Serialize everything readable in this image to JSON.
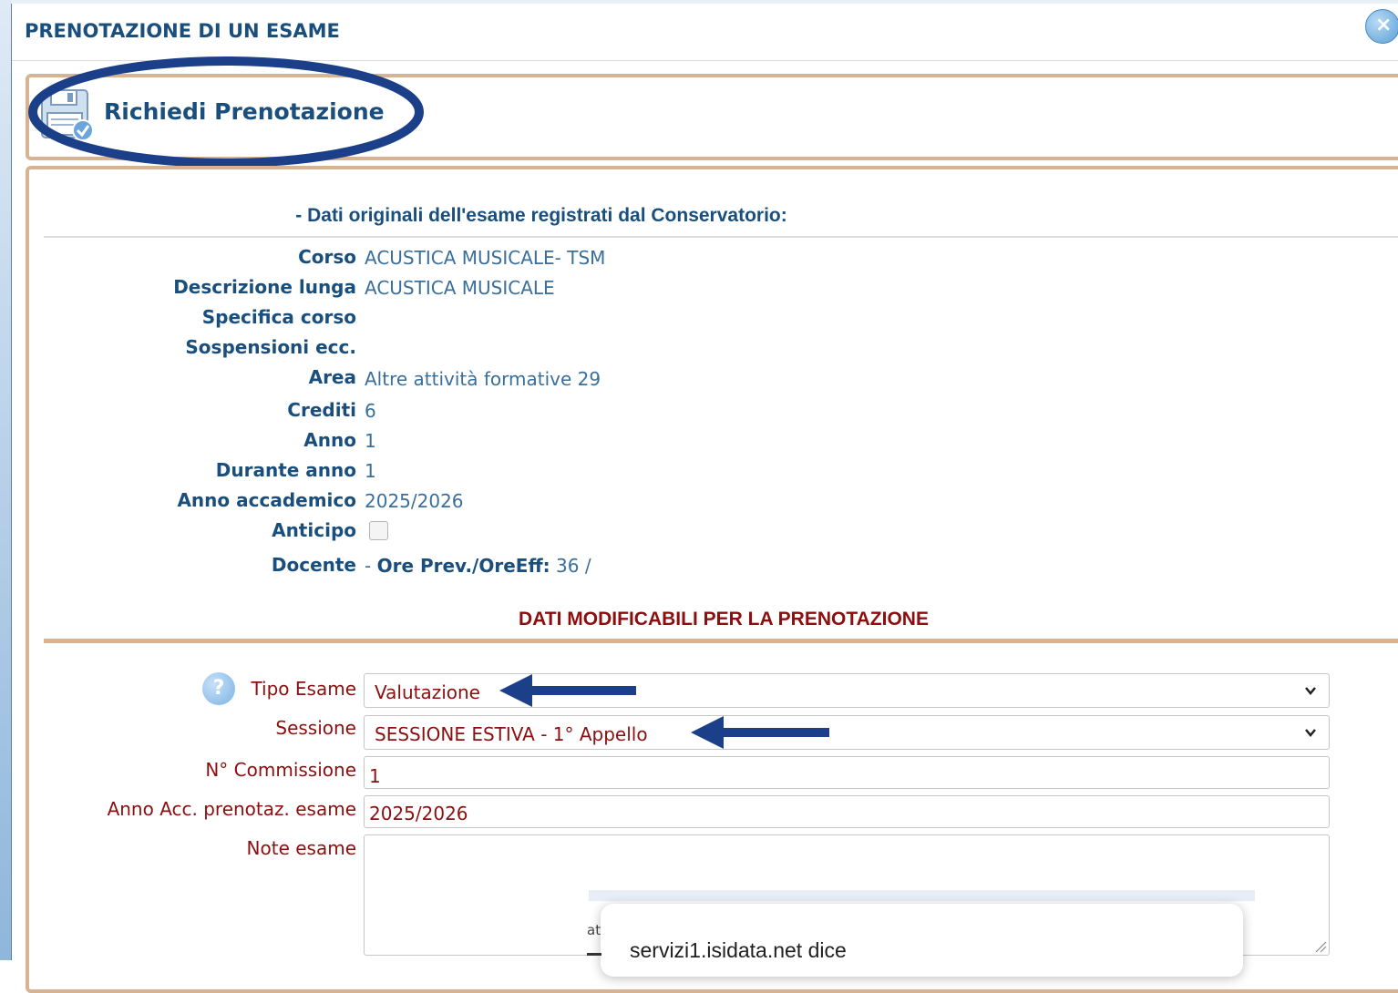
{
  "dialog": {
    "title": "PRENOTAZIONE DI UN ESAME",
    "close_icon": "close-icon"
  },
  "action": {
    "label": "Richiedi Prenotazione",
    "icon": "save-check-icon"
  },
  "original_data": {
    "title": "- Dati originali dell'esame registrati dal Conservatorio:",
    "rows": [
      {
        "label": "Corso",
        "value": "ACUSTICA MUSICALE- TSM"
      },
      {
        "label": "Descrizione lunga",
        "value": "ACUSTICA MUSICALE"
      },
      {
        "label": "Specifica corso",
        "value": ""
      },
      {
        "label": "Sospensioni ecc.",
        "value": ""
      },
      {
        "label": "Area",
        "value": "Altre attività formative 29"
      },
      {
        "label": "Crediti",
        "value": "6"
      },
      {
        "label": "Anno",
        "value": "1"
      },
      {
        "label": "Durante anno",
        "value": "1"
      },
      {
        "label": "Anno accademico",
        "value": "2025/2026"
      },
      {
        "label": "Anticipo",
        "value": ""
      }
    ],
    "docente": {
      "label": "Docente",
      "dash": "-",
      "ore_label": "Ore Prev./OreEff:",
      "ore_value": "36 /"
    }
  },
  "editable": {
    "title": "DATI MODIFICABILI PER LA PRENOTAZIONE",
    "help_icon": "?",
    "tipo_esame": {
      "label": "Tipo Esame",
      "value": "Valutazione"
    },
    "sessione": {
      "label": "Sessione",
      "value": "SESSIONE ESTIVA - 1° Appello"
    },
    "commissione": {
      "label": "N° Commissione",
      "value": "1"
    },
    "anno_acc": {
      "label": "Anno Acc. prenotaz. esame",
      "value": "2025/2026"
    },
    "note": {
      "label": "Note esame",
      "value": ""
    }
  },
  "alert": {
    "title": "servizi1.isidata.net dice",
    "partial_text": "at"
  },
  "colors": {
    "blue_text": "#1a4e7c",
    "dark_red_text": "#8b0f0f",
    "border_tan": "#d7b391",
    "annotation_navy": "#1c3f8a"
  }
}
